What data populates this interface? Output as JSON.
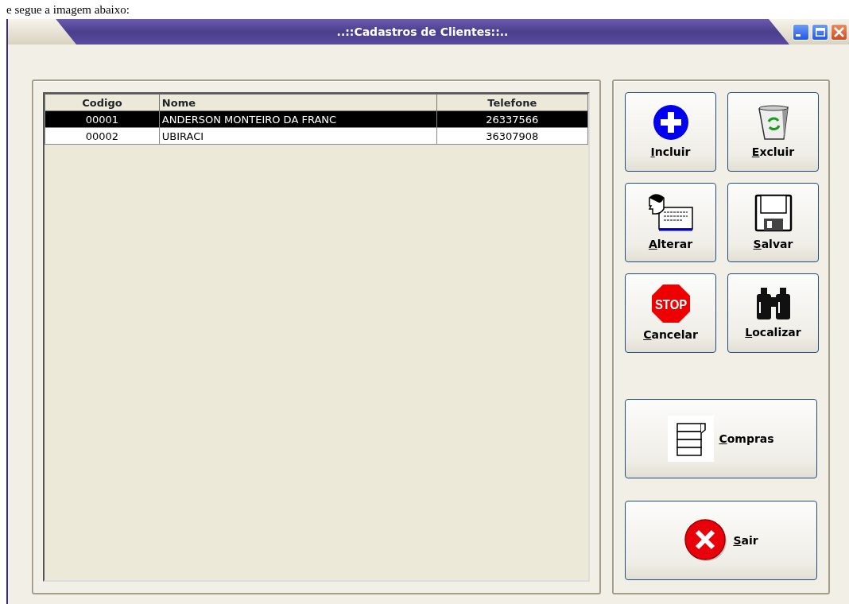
{
  "caption": "e segue a imagem abaixo:",
  "window": {
    "title": "..::Cadastros de Clientes::..",
    "controls": [
      {
        "kind": "minimize"
      },
      {
        "kind": "maximize"
      },
      {
        "kind": "close"
      }
    ]
  },
  "table": {
    "columns": [
      {
        "label": "Codigo"
      },
      {
        "label": "Nome"
      },
      {
        "label": "Telefone"
      }
    ],
    "rows": [
      {
        "cells": [
          "00001",
          "ANDERSON MONTEIRO DA FRANC",
          "26337566"
        ],
        "selected": true
      },
      {
        "cells": [
          "00002",
          "UBIRACI",
          "36307908"
        ],
        "selected": false
      }
    ]
  },
  "buttons": [
    {
      "label": "Incluir",
      "kind": "add",
      "mnemonic": true
    },
    {
      "label": "Excluir",
      "kind": "delete",
      "mnemonic": true
    },
    {
      "label": "Alterar",
      "kind": "edit",
      "mnemonic": true
    },
    {
      "label": "Salvar",
      "kind": "save",
      "mnemonic": true
    },
    {
      "label": "Cancelar",
      "kind": "cancel",
      "mnemonic": true,
      "icon_text": "STOP"
    },
    {
      "label": "Localizar",
      "kind": "find",
      "mnemonic": true
    }
  ],
  "wide_buttons": [
    {
      "label": "Compras",
      "kind": "purchases",
      "mnemonic": true
    },
    {
      "label": "Sair",
      "kind": "exit",
      "mnemonic": true
    }
  ]
}
